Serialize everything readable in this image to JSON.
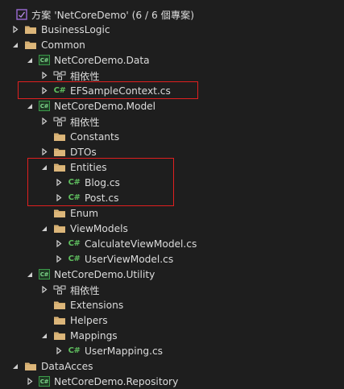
{
  "explorer": {
    "solution": {
      "label": "方案 'NetCoreDemo' (6 / 6 個專案)",
      "icon": "solution-icon"
    },
    "nodes": [
      {
        "label": "BusinessLogic",
        "type": "folder",
        "arrow": "collapsed"
      },
      {
        "label": "Common",
        "type": "folder",
        "arrow": "expanded"
      },
      {
        "label": "NetCoreDemo.Data",
        "type": "project",
        "arrow": "expanded"
      },
      {
        "label": "相依性",
        "type": "dependencies",
        "arrow": "collapsed"
      },
      {
        "label": "EFSampleContext.cs",
        "type": "csharp",
        "arrow": "collapsed"
      },
      {
        "label": "NetCoreDemo.Model",
        "type": "project",
        "arrow": "expanded"
      },
      {
        "label": "相依性",
        "type": "dependencies",
        "arrow": "collapsed"
      },
      {
        "label": "Constants",
        "type": "folder",
        "arrow": "none"
      },
      {
        "label": "DTOs",
        "type": "folder",
        "arrow": "collapsed"
      },
      {
        "label": "Entities",
        "type": "folder",
        "arrow": "expanded"
      },
      {
        "label": "Blog.cs",
        "type": "csharp",
        "arrow": "collapsed"
      },
      {
        "label": "Post.cs",
        "type": "csharp",
        "arrow": "collapsed"
      },
      {
        "label": "Enum",
        "type": "folder",
        "arrow": "none"
      },
      {
        "label": "ViewModels",
        "type": "folder",
        "arrow": "expanded"
      },
      {
        "label": "CalculateViewModel.cs",
        "type": "csharp",
        "arrow": "collapsed"
      },
      {
        "label": "UserViewModel.cs",
        "type": "csharp",
        "arrow": "collapsed"
      },
      {
        "label": "NetCoreDemo.Utility",
        "type": "project",
        "arrow": "expanded"
      },
      {
        "label": "相依性",
        "type": "dependencies",
        "arrow": "collapsed"
      },
      {
        "label": "Extensions",
        "type": "folder",
        "arrow": "none"
      },
      {
        "label": "Helpers",
        "type": "folder",
        "arrow": "none"
      },
      {
        "label": "Mappings",
        "type": "folder",
        "arrow": "expanded"
      },
      {
        "label": "UserMapping.cs",
        "type": "csharp",
        "arrow": "collapsed"
      },
      {
        "label": "DataAcces",
        "type": "folder",
        "arrow": "expanded"
      },
      {
        "label": "NetCoreDemo.Repository",
        "type": "project",
        "arrow": "collapsed"
      }
    ],
    "icon_text": {
      "project": "C#",
      "csharp": "C#"
    },
    "colors": {
      "background": "#1e1e1e",
      "text": "#dcdcdc",
      "folder": "#dcb67a",
      "csharp": "#5fbf5f",
      "project": "#3b9c4a",
      "solution": "#9b6bd6",
      "highlight": "#e02020"
    }
  }
}
